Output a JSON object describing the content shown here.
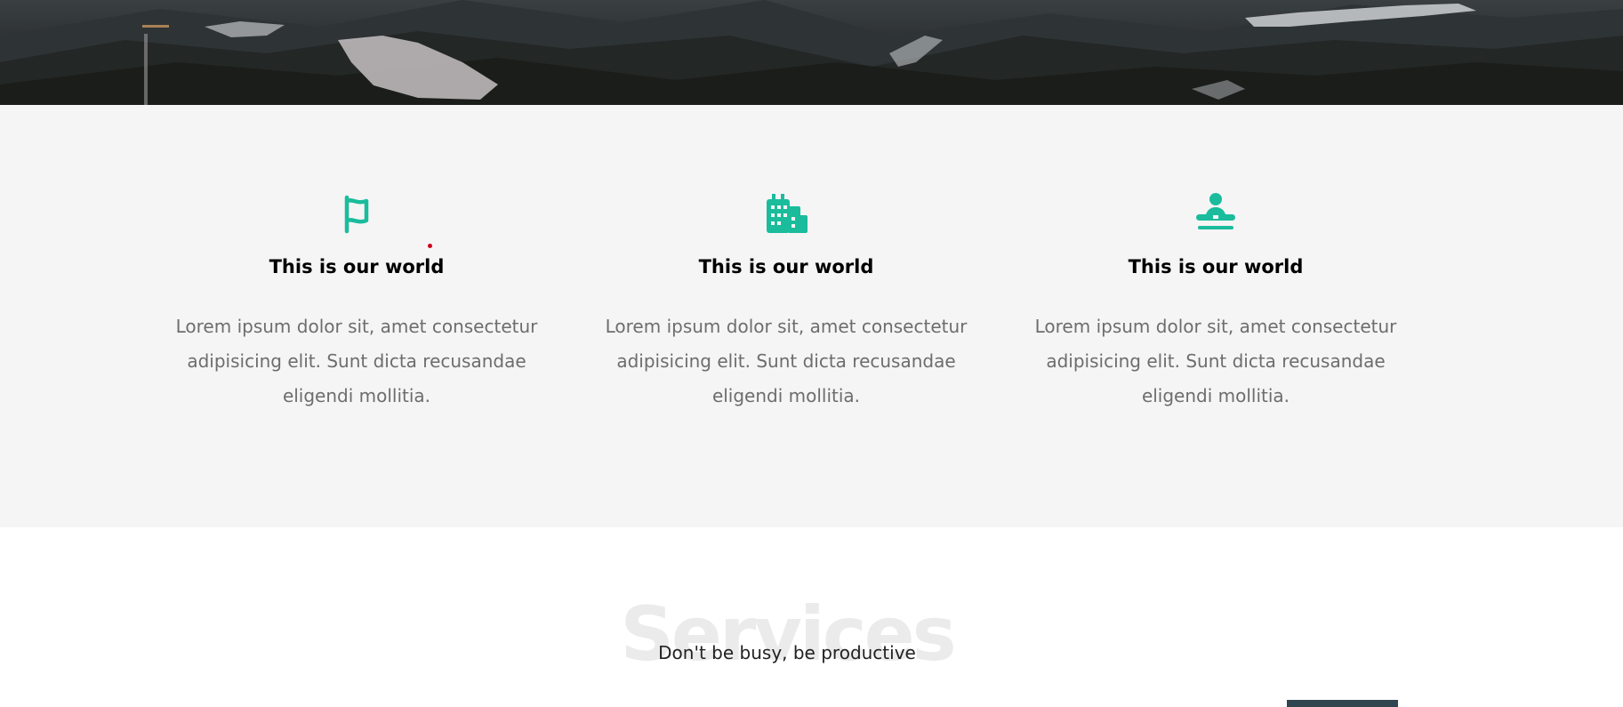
{
  "hero": {
    "image": "mountain-forest-night-photo"
  },
  "features": {
    "accent_color": "#1abc9c",
    "items": [
      {
        "icon": "flag-icon",
        "title": "This is our world",
        "text": "Lorem ipsum dolor sit, amet consectetur adipisicing elit. Sunt dicta recusandae eligendi mollitia."
      },
      {
        "icon": "building-icon",
        "title": "This is our world",
        "text": "Lorem ipsum dolor sit, amet consectetur adipisicing elit. Sunt dicta recusandae eligendi mollitia."
      },
      {
        "icon": "concierge-icon",
        "title": "This is our world",
        "text": "Lorem ipsum dolor sit, amet consectetur adipisicing elit. Sunt dicta recusandae eligendi mollitia."
      }
    ]
  },
  "services": {
    "background_title": "Services",
    "subtitle": "Don't be busy, be productive"
  }
}
